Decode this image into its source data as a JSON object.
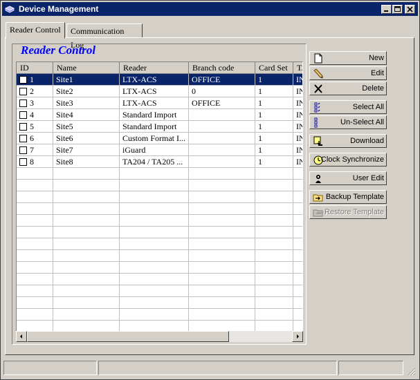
{
  "window": {
    "title": "Device Management"
  },
  "tabs": [
    {
      "label": "Reader Control"
    },
    {
      "label": "Communication Log"
    }
  ],
  "section_title": "Reader Control",
  "table": {
    "columns": [
      "ID",
      "Name",
      "Reader",
      "Branch code",
      "Card Set",
      "TA"
    ],
    "rows": [
      {
        "id": "1",
        "name": "Site1",
        "reader": "LTX-ACS",
        "branch": "OFFICE",
        "cardset": "1",
        "ta": "IN",
        "checked": false,
        "selected": true
      },
      {
        "id": "2",
        "name": "Site2",
        "reader": "LTX-ACS",
        "branch": "0",
        "cardset": "1",
        "ta": "IN",
        "checked": false,
        "selected": false
      },
      {
        "id": "3",
        "name": "Site3",
        "reader": "LTX-ACS",
        "branch": "OFFICE",
        "cardset": "1",
        "ta": "IN",
        "checked": false,
        "selected": false
      },
      {
        "id": "4",
        "name": "Site4",
        "reader": "Standard Import",
        "branch": "",
        "cardset": "1",
        "ta": "IN",
        "checked": false,
        "selected": false
      },
      {
        "id": "5",
        "name": "Site5",
        "reader": "Standard Import",
        "branch": "",
        "cardset": "1",
        "ta": "IN",
        "checked": false,
        "selected": false
      },
      {
        "id": "6",
        "name": "Site6",
        "reader": "Custom Format I...",
        "branch": "",
        "cardset": "1",
        "ta": "IN",
        "checked": false,
        "selected": false
      },
      {
        "id": "7",
        "name": "Site7",
        "reader": "iGuard",
        "branch": "",
        "cardset": "1",
        "ta": "IN",
        "checked": false,
        "selected": false
      },
      {
        "id": "8",
        "name": "Site8",
        "reader": "TA204 / TA205 ...",
        "branch": "",
        "cardset": "1",
        "ta": "IN",
        "checked": false,
        "selected": false
      }
    ]
  },
  "buttons": {
    "new": "New",
    "edit": "Edit",
    "delete": "Delete",
    "select_all": "Select All",
    "unselect_all": "Un-Select All",
    "download": "Download",
    "clock_sync": "Clock Synchronize",
    "user_edit": "User Edit",
    "backup_template": "Backup Template",
    "restore_template": "Restore Template"
  },
  "icons": {
    "new": "new-document-icon",
    "edit": "pencil-icon",
    "delete": "x-delete-icon",
    "select_all": "checklist-icon",
    "unselect_all": "unchecklist-icon",
    "download": "download-icon",
    "clock_sync": "clock-icon",
    "user_edit": "user-icon",
    "backup": "backup-folder-icon",
    "restore": "restore-folder-icon"
  },
  "colors": {
    "titlebar": "#0a246a",
    "selection": "#0a246a",
    "section_title": "#0000ff",
    "face": "#d4d0c8"
  }
}
